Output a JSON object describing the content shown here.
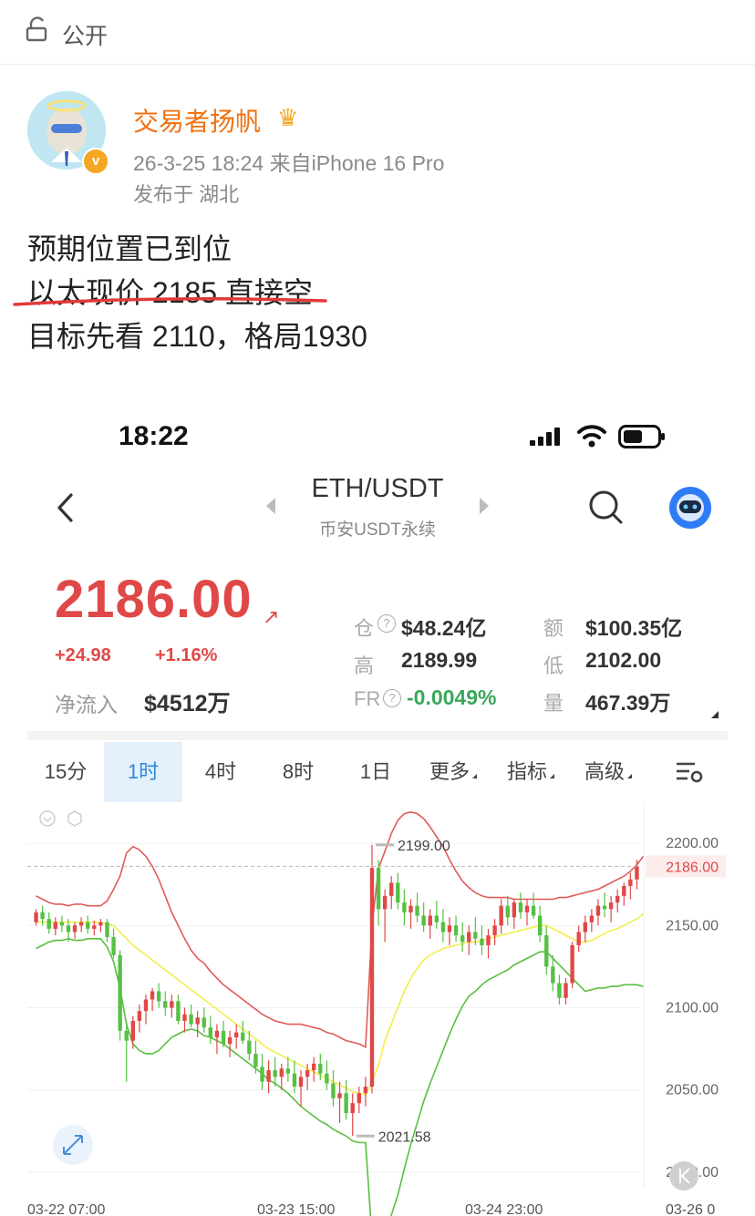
{
  "post_header": {
    "visibility": "公开"
  },
  "author": {
    "name": "交易者扬帆",
    "verified_badge": "v",
    "meta": "26-3-25 18:24 来自iPhone 16 Pro",
    "location": "发布于 湖北"
  },
  "post": {
    "lines": [
      "预期位置已到位",
      "以太现价 2185 直接空",
      "目标先看 2110，格局1930"
    ]
  },
  "screenshot": {
    "status_time": "18:22",
    "pair": "ETH/USDT",
    "pair_sub": "币安USDT永续",
    "price": "2186.00",
    "change_abs": "+24.98",
    "change_pct": "+1.16%",
    "inflow_label": "净流入",
    "inflow_value": "$4512万",
    "stats": {
      "oi_label": "仓",
      "oi_value": "$48.24亿",
      "amt_label": "额",
      "amt_value": "$100.35亿",
      "high_label": "高",
      "high_value": "2189.99",
      "low_label": "低",
      "low_value": "2102.00",
      "fr_label": "FR",
      "fr_value": "-0.0049%",
      "vol_label": "量",
      "vol_value": "467.39万"
    },
    "tabs": [
      "15分",
      "1时",
      "4时",
      "8时",
      "1日",
      "更多",
      "指标",
      "高级"
    ],
    "active_tab": "1时"
  },
  "colors": {
    "up": "#e04848",
    "down": "#56c043",
    "upper_band": "#e25a5a",
    "mid_band": "#f2ee4a",
    "lower_band": "#58bf3e",
    "author": "#f2700f",
    "accent": "#2f86d8"
  },
  "chart_data": {
    "type": "candlestick",
    "ylim": [
      1990,
      2225
    ],
    "y_ticks": [
      "2200.00",
      "2150.00",
      "2100.00",
      "2050.00",
      "2000.00"
    ],
    "current_price": "2186.00",
    "x_ticks": [
      "03-22 07:00",
      "03-23 15:00",
      "03-24 23:00",
      "03-26 0"
    ],
    "annotations": {
      "high": "2199.00",
      "low": "2021.58"
    },
    "candles_ohlc": [
      [
        2152,
        2160,
        2150,
        2158
      ],
      [
        2158,
        2162,
        2150,
        2154
      ],
      [
        2154,
        2158,
        2145,
        2148
      ],
      [
        2148,
        2155,
        2144,
        2152
      ],
      [
        2152,
        2156,
        2146,
        2150
      ],
      [
        2150,
        2154,
        2140,
        2146
      ],
      [
        2146,
        2152,
        2142,
        2150
      ],
      [
        2150,
        2155,
        2146,
        2152
      ],
      [
        2152,
        2156,
        2145,
        2148
      ],
      [
        2148,
        2153,
        2144,
        2150
      ],
      [
        2150,
        2154,
        2146,
        2152
      ],
      [
        2152,
        2154,
        2140,
        2143
      ],
      [
        2143,
        2148,
        2130,
        2132
      ],
      [
        2132,
        2135,
        2080,
        2086
      ],
      [
        2086,
        2092,
        2055,
        2080
      ],
      [
        2080,
        2095,
        2075,
        2092
      ],
      [
        2092,
        2102,
        2085,
        2098
      ],
      [
        2098,
        2108,
        2090,
        2105
      ],
      [
        2105,
        2112,
        2098,
        2110
      ],
      [
        2110,
        2115,
        2100,
        2104
      ],
      [
        2104,
        2110,
        2095,
        2100
      ],
      [
        2100,
        2108,
        2094,
        2104
      ],
      [
        2104,
        2108,
        2090,
        2092
      ],
      [
        2092,
        2100,
        2085,
        2096
      ],
      [
        2096,
        2102,
        2088,
        2090
      ],
      [
        2090,
        2098,
        2082,
        2094
      ],
      [
        2094,
        2100,
        2085,
        2088
      ],
      [
        2088,
        2095,
        2078,
        2082
      ],
      [
        2082,
        2090,
        2072,
        2086
      ],
      [
        2086,
        2092,
        2076,
        2078
      ],
      [
        2078,
        2086,
        2070,
        2082
      ],
      [
        2082,
        2090,
        2075,
        2085
      ],
      [
        2085,
        2092,
        2078,
        2080
      ],
      [
        2080,
        2086,
        2068,
        2072
      ],
      [
        2072,
        2080,
        2060,
        2064
      ],
      [
        2064,
        2072,
        2050,
        2055
      ],
      [
        2055,
        2068,
        2048,
        2062
      ],
      [
        2062,
        2070,
        2052,
        2058
      ],
      [
        2058,
        2066,
        2050,
        2063
      ],
      [
        2063,
        2070,
        2055,
        2060
      ],
      [
        2060,
        2068,
        2048,
        2052
      ],
      [
        2052,
        2062,
        2040,
        2058
      ],
      [
        2058,
        2066,
        2050,
        2062
      ],
      [
        2062,
        2070,
        2055,
        2066
      ],
      [
        2066,
        2072,
        2056,
        2060
      ],
      [
        2060,
        2068,
        2050,
        2054
      ],
      [
        2054,
        2062,
        2040,
        2045
      ],
      [
        2045,
        2055,
        2030,
        2048
      ],
      [
        2048,
        2056,
        2032,
        2036
      ],
      [
        2036,
        2048,
        2022,
        2042
      ],
      [
        2042,
        2052,
        2036,
        2048
      ],
      [
        2048,
        2058,
        2040,
        2052
      ],
      [
        2052,
        2199,
        2048,
        2185
      ],
      [
        2185,
        2190,
        2150,
        2160
      ],
      [
        2160,
        2172,
        2140,
        2168
      ],
      [
        2168,
        2180,
        2160,
        2176
      ],
      [
        2176,
        2182,
        2160,
        2164
      ],
      [
        2164,
        2172,
        2150,
        2158
      ],
      [
        2158,
        2166,
        2148,
        2162
      ],
      [
        2162,
        2170,
        2152,
        2156
      ],
      [
        2156,
        2164,
        2146,
        2150
      ],
      [
        2150,
        2160,
        2142,
        2156
      ],
      [
        2156,
        2165,
        2148,
        2152
      ],
      [
        2152,
        2160,
        2140,
        2146
      ],
      [
        2146,
        2155,
        2138,
        2150
      ],
      [
        2150,
        2156,
        2140,
        2144
      ],
      [
        2144,
        2152,
        2134,
        2140
      ],
      [
        2140,
        2150,
        2132,
        2146
      ],
      [
        2146,
        2155,
        2138,
        2142
      ],
      [
        2142,
        2150,
        2132,
        2138
      ],
      [
        2138,
        2148,
        2130,
        2144
      ],
      [
        2144,
        2154,
        2138,
        2150
      ],
      [
        2150,
        2166,
        2145,
        2162
      ],
      [
        2162,
        2168,
        2150,
        2155
      ],
      [
        2155,
        2166,
        2148,
        2164
      ],
      [
        2164,
        2170,
        2154,
        2158
      ],
      [
        2158,
        2166,
        2150,
        2162
      ],
      [
        2162,
        2170,
        2154,
        2156
      ],
      [
        2156,
        2162,
        2140,
        2144
      ],
      [
        2144,
        2150,
        2120,
        2125
      ],
      [
        2125,
        2132,
        2110,
        2115
      ],
      [
        2115,
        2120,
        2102,
        2106
      ],
      [
        2106,
        2118,
        2102,
        2115
      ],
      [
        2115,
        2140,
        2112,
        2138
      ],
      [
        2138,
        2150,
        2134,
        2146
      ],
      [
        2146,
        2156,
        2140,
        2152
      ],
      [
        2152,
        2160,
        2146,
        2156
      ],
      [
        2156,
        2166,
        2150,
        2162
      ],
      [
        2162,
        2170,
        2155,
        2160
      ],
      [
        2160,
        2168,
        2152,
        2164
      ],
      [
        2164,
        2172,
        2158,
        2168
      ],
      [
        2168,
        2176,
        2162,
        2174
      ],
      [
        2174,
        2182,
        2166,
        2178
      ],
      [
        2178,
        2190,
        2172,
        2186
      ]
    ],
    "upper_band": [
      2168,
      2166,
      2164,
      2163,
      2163,
      2162,
      2163,
      2163,
      2162,
      2162,
      2162,
      2165,
      2172,
      2180,
      2194,
      2198,
      2196,
      2192,
      2186,
      2178,
      2168,
      2158,
      2150,
      2142,
      2135,
      2130,
      2127,
      2122,
      2118,
      2114,
      2111,
      2108,
      2105,
      2102,
      2099,
      2096,
      2094,
      2092,
      2091,
      2090,
      2090,
      2090,
      2089,
      2088,
      2087,
      2085,
      2084,
      2082,
      2080,
      2079,
      2078,
      2076,
      2150,
      2185,
      2195,
      2206,
      2214,
      2218,
      2219,
      2218,
      2215,
      2210,
      2204,
      2198,
      2190,
      2183,
      2177,
      2173,
      2170,
      2168,
      2167,
      2167,
      2167,
      2167,
      2166,
      2166,
      2166,
      2166,
      2166,
      2166,
      2166,
      2167,
      2167,
      2168,
      2169,
      2170,
      2171,
      2172,
      2174,
      2176,
      2178,
      2180,
      2183,
      2187,
      2192
    ],
    "mid_band": [
      2152,
      2152,
      2152,
      2152,
      2152,
      2152,
      2152,
      2152,
      2152,
      2152,
      2152,
      2151,
      2150,
      2146,
      2142,
      2138,
      2135,
      2132,
      2129,
      2126,
      2123,
      2120,
      2117,
      2114,
      2111,
      2108,
      2105,
      2102,
      2099,
      2096,
      2093,
      2090,
      2087,
      2084,
      2081,
      2078,
      2075,
      2073,
      2071,
      2069,
      2067,
      2065,
      2063,
      2061,
      2059,
      2057,
      2055,
      2053,
      2051,
      2049,
      2048,
      2047,
      2055,
      2065,
      2080,
      2090,
      2100,
      2110,
      2118,
      2124,
      2129,
      2132,
      2134,
      2136,
      2137,
      2138,
      2139,
      2140,
      2140,
      2141,
      2142,
      2143,
      2144,
      2145,
      2146,
      2147,
      2148,
      2149,
      2150,
      2150,
      2148,
      2146,
      2144,
      2142,
      2140,
      2140,
      2141,
      2143,
      2145,
      2147,
      2148,
      2150,
      2152,
      2154,
      2157
    ],
    "lower_band": [
      2136,
      2138,
      2140,
      2141,
      2141,
      2142,
      2141,
      2141,
      2142,
      2142,
      2142,
      2137,
      2128,
      2112,
      2090,
      2078,
      2074,
      2072,
      2072,
      2074,
      2078,
      2082,
      2084,
      2086,
      2087,
      2086,
      2083,
      2082,
      2080,
      2078,
      2075,
      2072,
      2069,
      2066,
      2063,
      2060,
      2056,
      2054,
      2051,
      2048,
      2044,
      2040,
      2037,
      2034,
      2031,
      2029,
      2026,
      2024,
      2022,
      2019,
      2018,
      2018,
      1960,
      1945,
      1965,
      1974,
      1986,
      2002,
      2017,
      2030,
      2043,
      2054,
      2064,
      2074,
      2084,
      2093,
      2101,
      2107,
      2110,
      2114,
      2117,
      2119,
      2121,
      2123,
      2126,
      2128,
      2130,
      2132,
      2134,
      2134,
      2130,
      2126,
      2122,
      2118,
      2114,
      2110,
      2111,
      2112,
      2112,
      2113,
      2113,
      2114,
      2114,
      2114,
      2113
    ]
  }
}
